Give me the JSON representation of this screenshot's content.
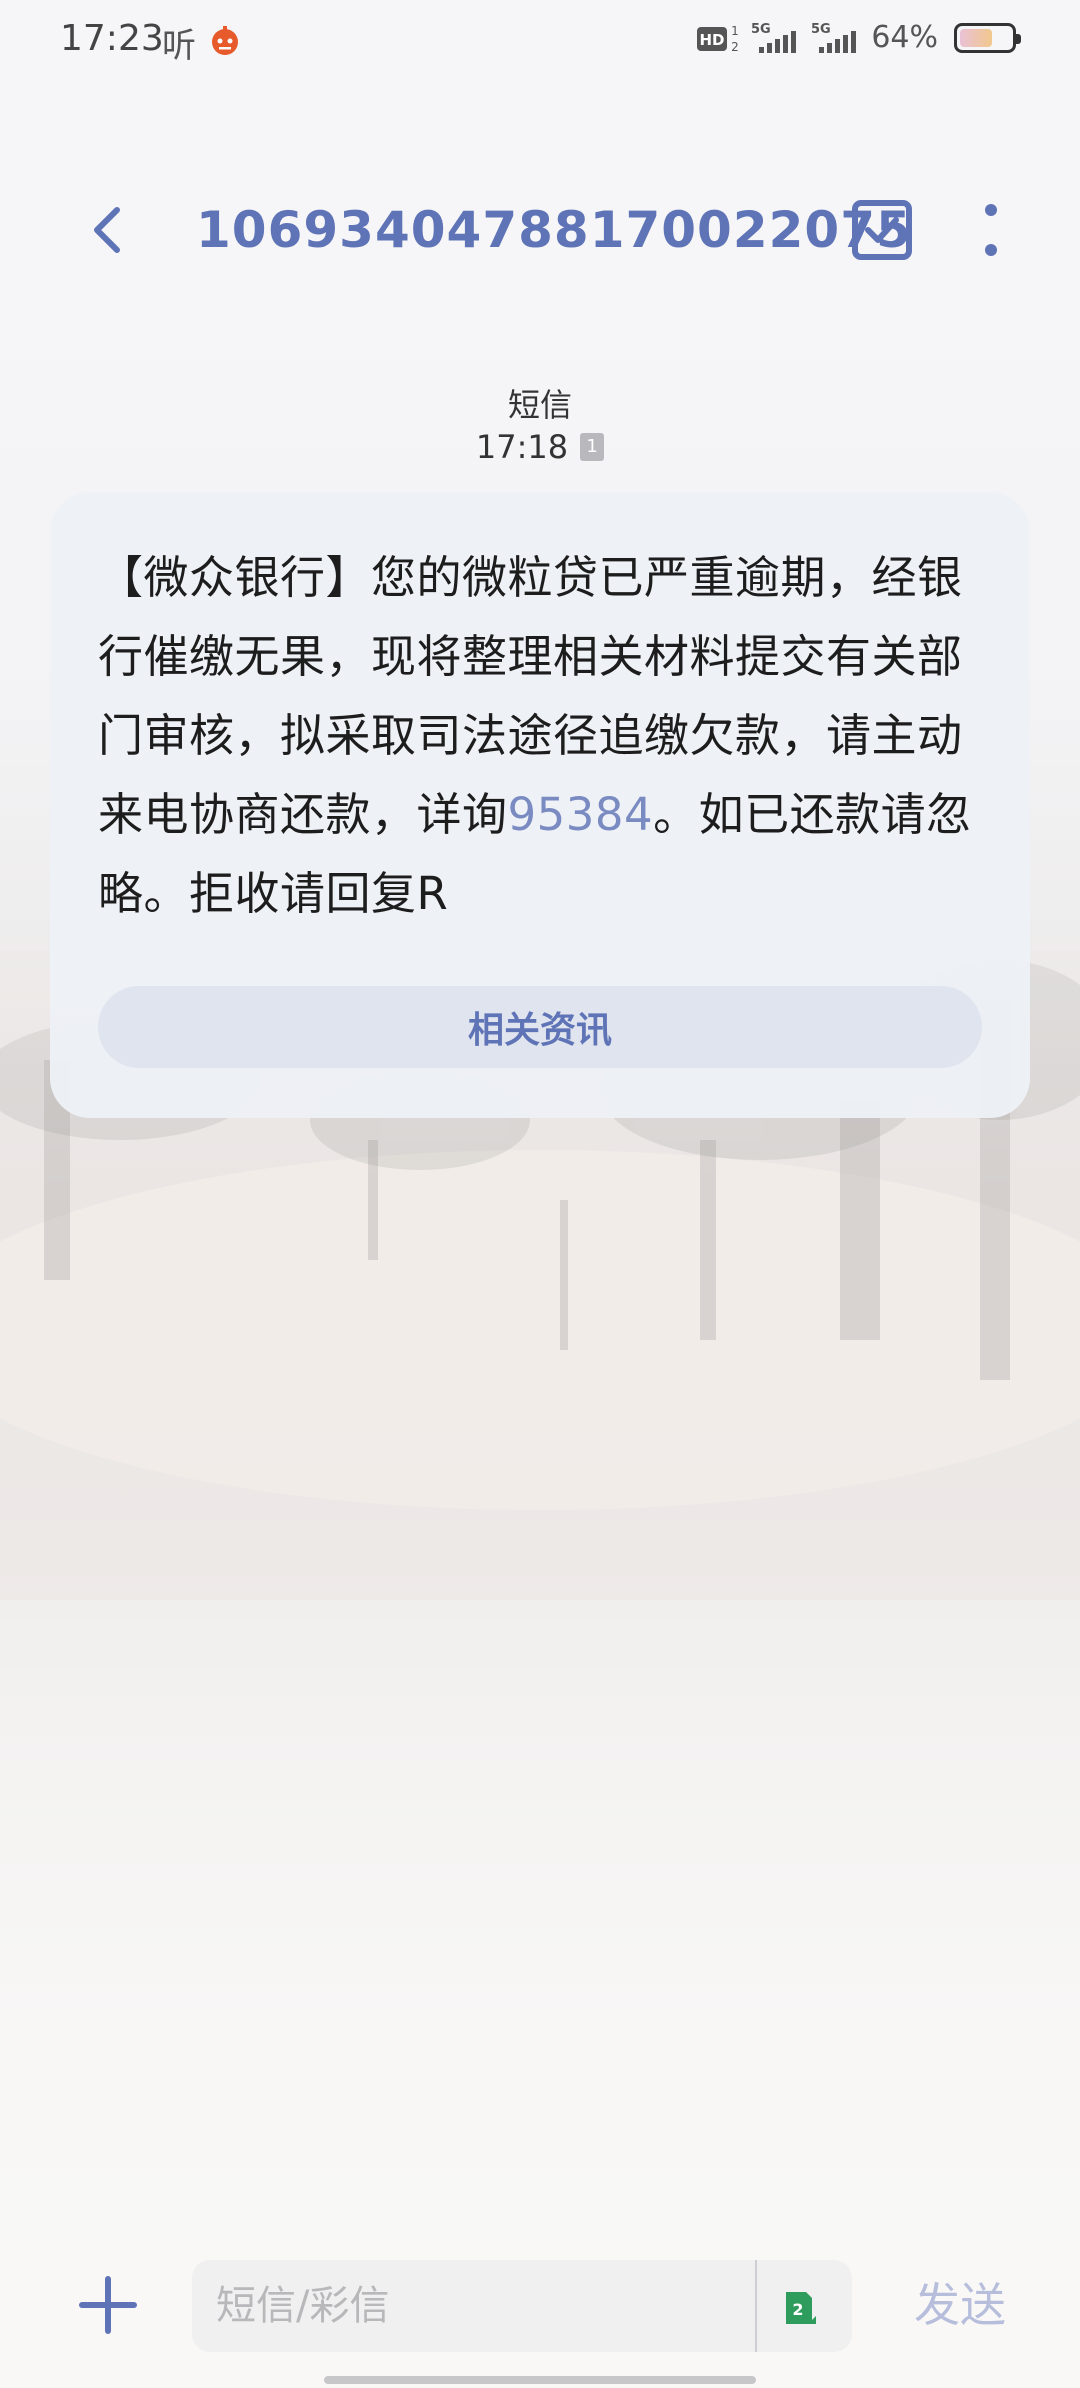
{
  "status_bar": {
    "time": "17:23",
    "ting_label": "听",
    "network_labels": [
      "HD",
      "5G",
      "5G"
    ],
    "battery_percent": "64%",
    "battery_level": 0.64
  },
  "header": {
    "title": "10693404788170022075",
    "back_icon": "chevron-left-icon",
    "select_icon": "checkbox-checked-icon",
    "more_icon": "more-vertical-icon"
  },
  "message": {
    "source_label": "短信",
    "time": "17:18",
    "sim_slot": "1",
    "text_before_link": "【微众银行】您的微粒贷已严重逾期，经银行催缴无果，现将整理相关材料提交有关部门审核，拟采取司法途径追缴欠款，请主动来电协商还款，详询",
    "link_number": "95384",
    "text_after_link": "。如已还款请忽略。拒收请回复R",
    "related_button_label": "相关资讯"
  },
  "composer": {
    "placeholder": "短信/彩信",
    "sim_selected": "2",
    "send_label": "发送",
    "add_icon": "plus-icon"
  },
  "colors": {
    "accent": "#5f74b6",
    "link": "#7a8bc2",
    "bubble": "#edf0f6",
    "sim2_green": "#2e9c5d"
  }
}
